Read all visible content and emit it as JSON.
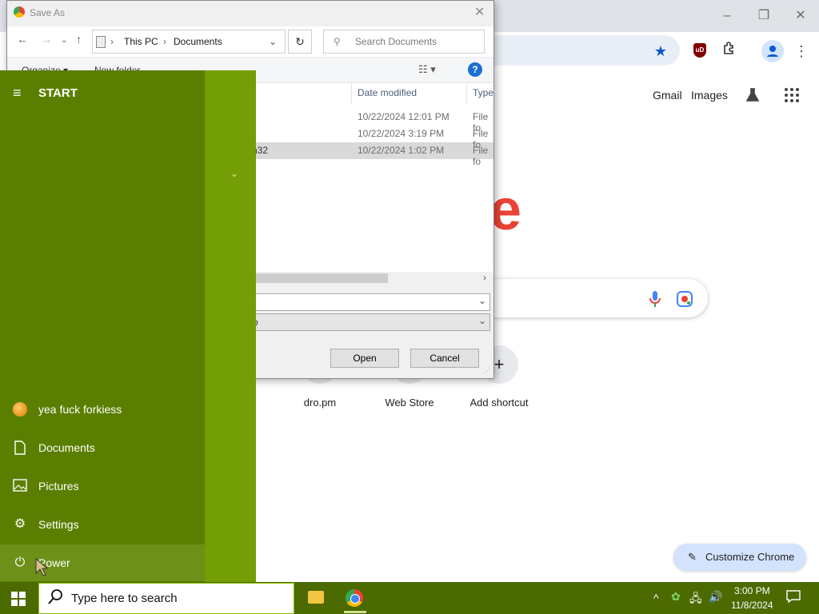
{
  "chrome": {
    "window_controls": [
      "–",
      "❐",
      "✕"
    ],
    "header_links": [
      "Gmail",
      "Images"
    ],
    "logo_fragment": "e",
    "shortcuts": [
      {
        "label": "dro.pm"
      },
      {
        "label": "Web Store"
      },
      {
        "label": "Add shortcut"
      }
    ],
    "customize_label": "Customize Chrome",
    "colors": {
      "accent": "#0b57d0",
      "logo_red": "#ea4335",
      "ublock": "#800000"
    }
  },
  "dialog": {
    "title": "Save As",
    "breadcrumb": [
      "This PC",
      "Documents"
    ],
    "search_placeholder": "Search Documents",
    "toolbar": {
      "organize": "Organize ▾",
      "new_folder": "New folder"
    },
    "columns": [
      "Date modified",
      "Type"
    ],
    "rows": [
      {
        "name": "",
        "date": "10/22/2024 12:01 PM",
        "type": "File fo"
      },
      {
        "name": "",
        "date": "10/22/2024 3:19 PM",
        "type": "File fo"
      },
      {
        "name": "n32",
        "date": "10/22/2024 1:02 PM",
        "type": "File fo"
      }
    ],
    "save_type_fragment": "o",
    "open_label": "Open",
    "cancel_label": "Cancel"
  },
  "start_menu": {
    "header": "START",
    "items": [
      {
        "label": "yea fuck forkiess",
        "icon": "user-avatar"
      },
      {
        "label": "Documents",
        "icon": "document-icon"
      },
      {
        "label": "Pictures",
        "icon": "pictures-icon"
      },
      {
        "label": "Settings",
        "icon": "gear-icon"
      },
      {
        "label": "Power",
        "icon": "power-icon"
      }
    ]
  },
  "taskbar": {
    "search_placeholder": "Type here to search",
    "time": "3:00 PM",
    "date": "11/8/2024"
  }
}
